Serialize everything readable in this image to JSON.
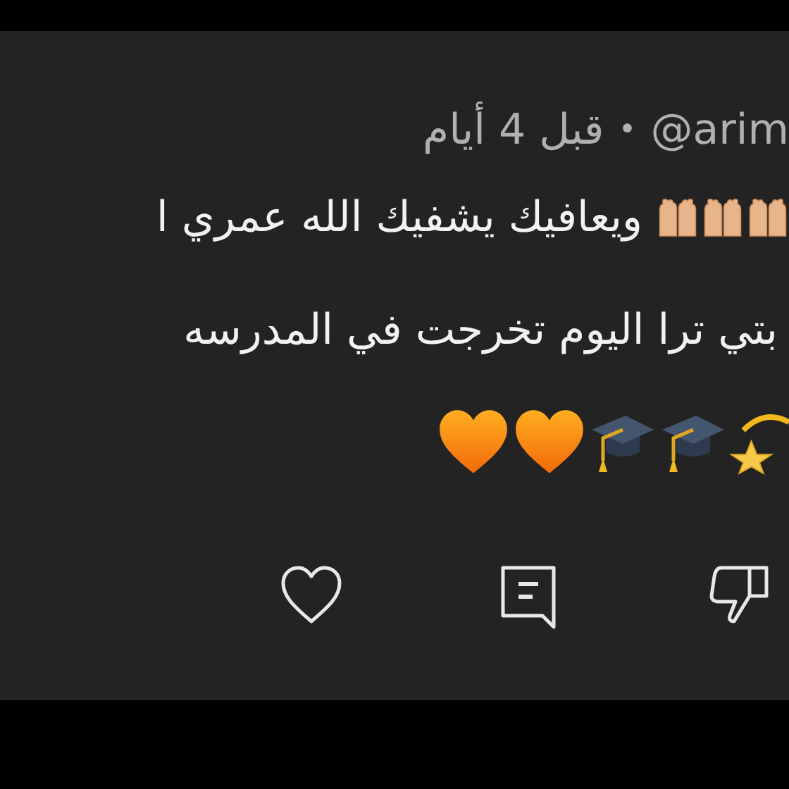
{
  "comment": {
    "author": "@arim",
    "separator": "•",
    "time": "قبل 4 أيام",
    "lines": [
      {
        "text": "ويعافيك يشفيك الله عمري ا",
        "icons": [
          {
            "kind": "hands"
          },
          {
            "kind": "hands"
          },
          {
            "kind": "hands"
          }
        ]
      },
      {
        "text": "بتي ترا اليوم تخرجت في المدرسه"
      },
      {
        "icons": [
          {
            "kind": "heart"
          },
          {
            "kind": "heart"
          },
          {
            "kind": "cap"
          },
          {
            "kind": "cap"
          },
          {
            "kind": "star"
          }
        ]
      }
    ]
  },
  "actions": [
    {
      "kind": "like"
    },
    {
      "kind": "reply"
    },
    {
      "kind": "dislike"
    }
  ]
}
